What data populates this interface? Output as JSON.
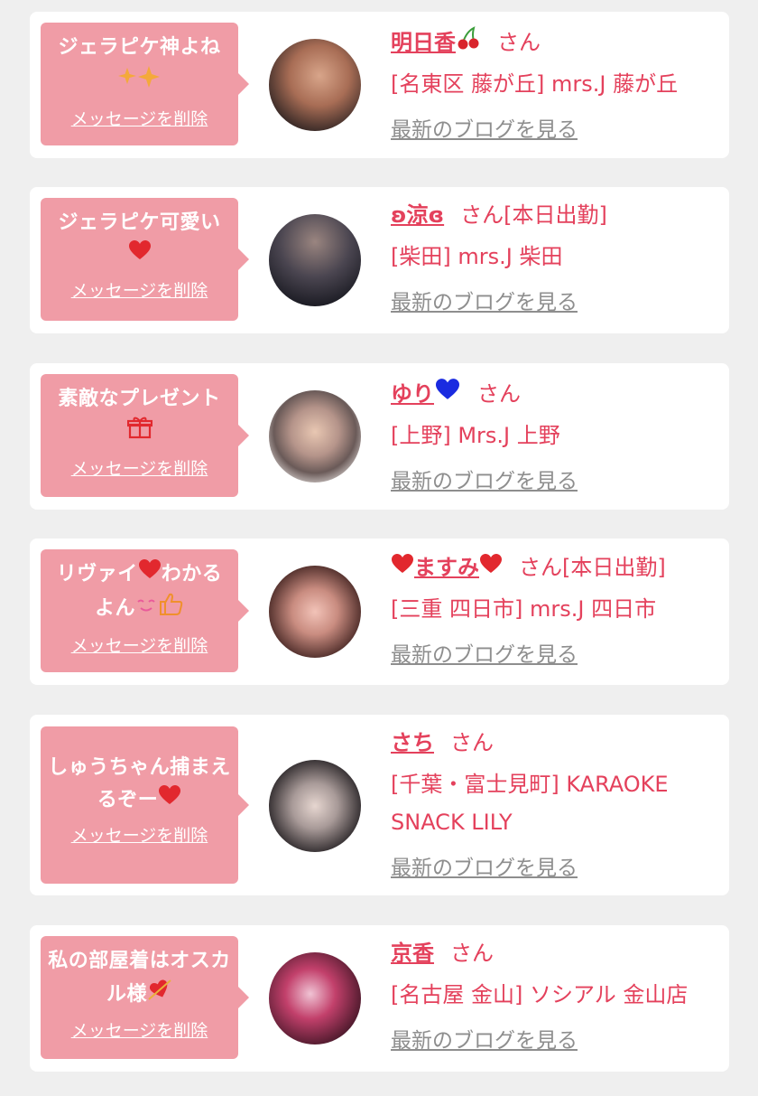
{
  "delete_label": "メッセージを削除",
  "blog_label": "最新のブログを見る",
  "colors": {
    "bubble": "#f09ca6",
    "accent": "#e4415c",
    "muted": "#8e8e8e"
  },
  "items": [
    {
      "message": "ジェラピケ神よね",
      "message_icon": "sparkles-icon",
      "name": "明日香",
      "name_icon": "cherries-icon",
      "suffix": "さん",
      "shop": "[名東区 藤が丘] mrs.J 藤が丘"
    },
    {
      "message": "ジェラピケ可愛い",
      "message_icon": "heart-icon",
      "name": "ʚ涼ɞ",
      "suffix": "さん[本日出勤]",
      "shop": "[柴田] mrs.J 柴田"
    },
    {
      "message": "素敵なプレゼント",
      "message_icon": "gift-icon",
      "name": "ゆり",
      "name_icon": "blue-heart-icon",
      "suffix": "さん",
      "shop": "[上野] Mrs.J 上野"
    },
    {
      "message_parts": [
        "リヴァイ",
        "わかる",
        "よん"
      ],
      "message_icons": [
        "heart-icon",
        "smile-icon",
        "thumbs-up-icon"
      ],
      "name": "ますみ",
      "name_icon": "heart-icon",
      "suffix": "さん[本日出勤]",
      "shop": "[三重 四日市] mrs.J 四日市"
    },
    {
      "message": "しゅうちゃん捕まえるぞー",
      "message_icon": "heart-icon",
      "name": "さち",
      "suffix": "さん",
      "shop": "[千葉・富士見町] KARAOKE SNACK LILY"
    },
    {
      "message": "私の部屋着はオスカル様",
      "message_icon": "heart-arrow-icon",
      "name": "京香",
      "suffix": "さん",
      "shop": "[名古屋 金山] ソシアル 金山店"
    }
  ]
}
